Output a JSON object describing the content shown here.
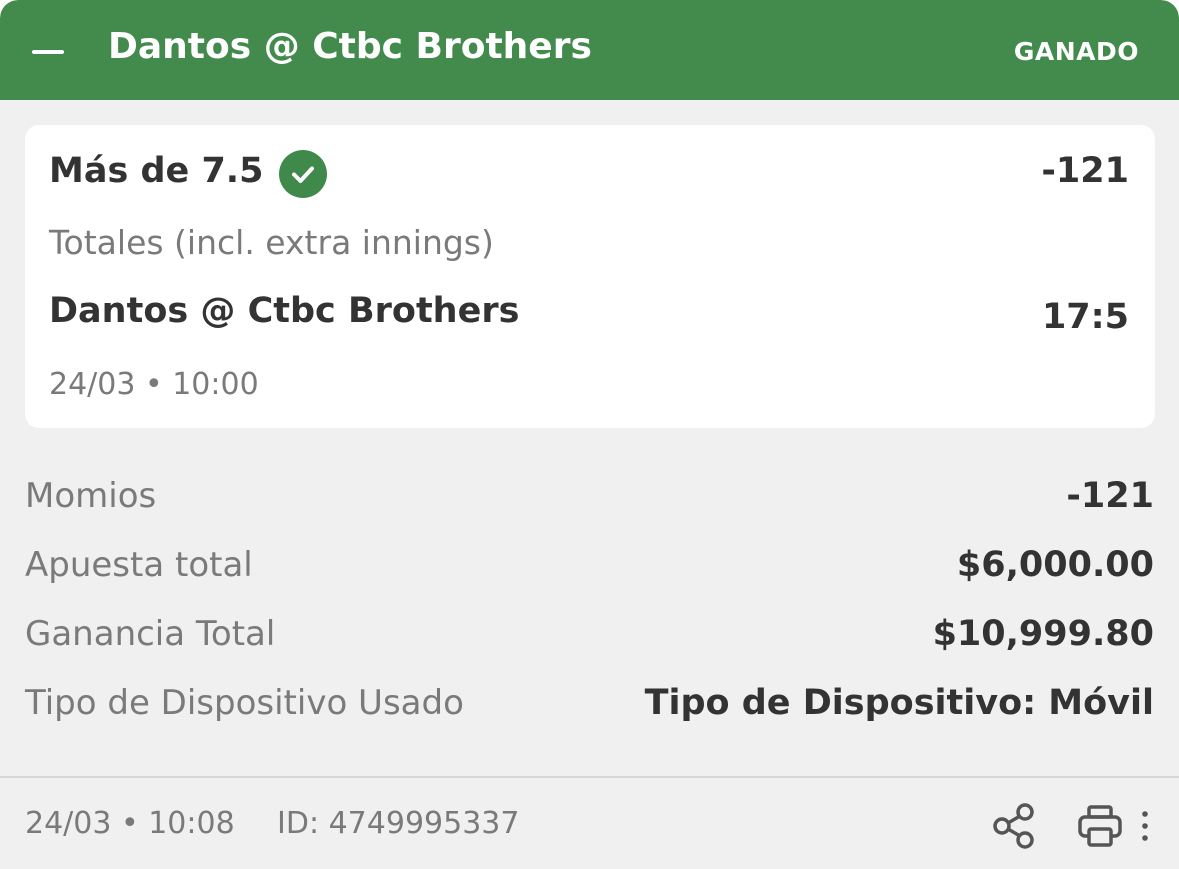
{
  "header": {
    "title": "Dantos @ Ctbc Brothers",
    "status": "GANADO",
    "color": "#438b4d",
    "collapse_icon": "minus-icon"
  },
  "selection": {
    "market": "Más de 7.5",
    "status_icon": "check-circle-icon",
    "odds": "-121",
    "bet_type": "Totales (incl. extra innings)",
    "event": "Dantos @ Ctbc Brothers",
    "score": "17:5",
    "datetime": "24/03 • 10:00"
  },
  "summary": {
    "momios": {
      "label": "Momios",
      "value": "-121"
    },
    "stake": {
      "label": "Apuesta total",
      "value": "$6,000.00"
    },
    "payout": {
      "label": "Ganancia Total",
      "value": "$10,999.80"
    },
    "device": {
      "label": "Tipo de Dispositivo Usado",
      "value": "Tipo de Dispositivo: Móvil"
    }
  },
  "footer": {
    "datetime": "24/03 • 10:08",
    "id": "ID: 4749995337",
    "icons": [
      "share-icon",
      "print-icon",
      "more-vertical-icon"
    ]
  },
  "colors": {
    "accent": "#438b4d",
    "background": "#f0f0f0",
    "text_primary": "#333333",
    "text_secondary": "#7a7a7a"
  }
}
